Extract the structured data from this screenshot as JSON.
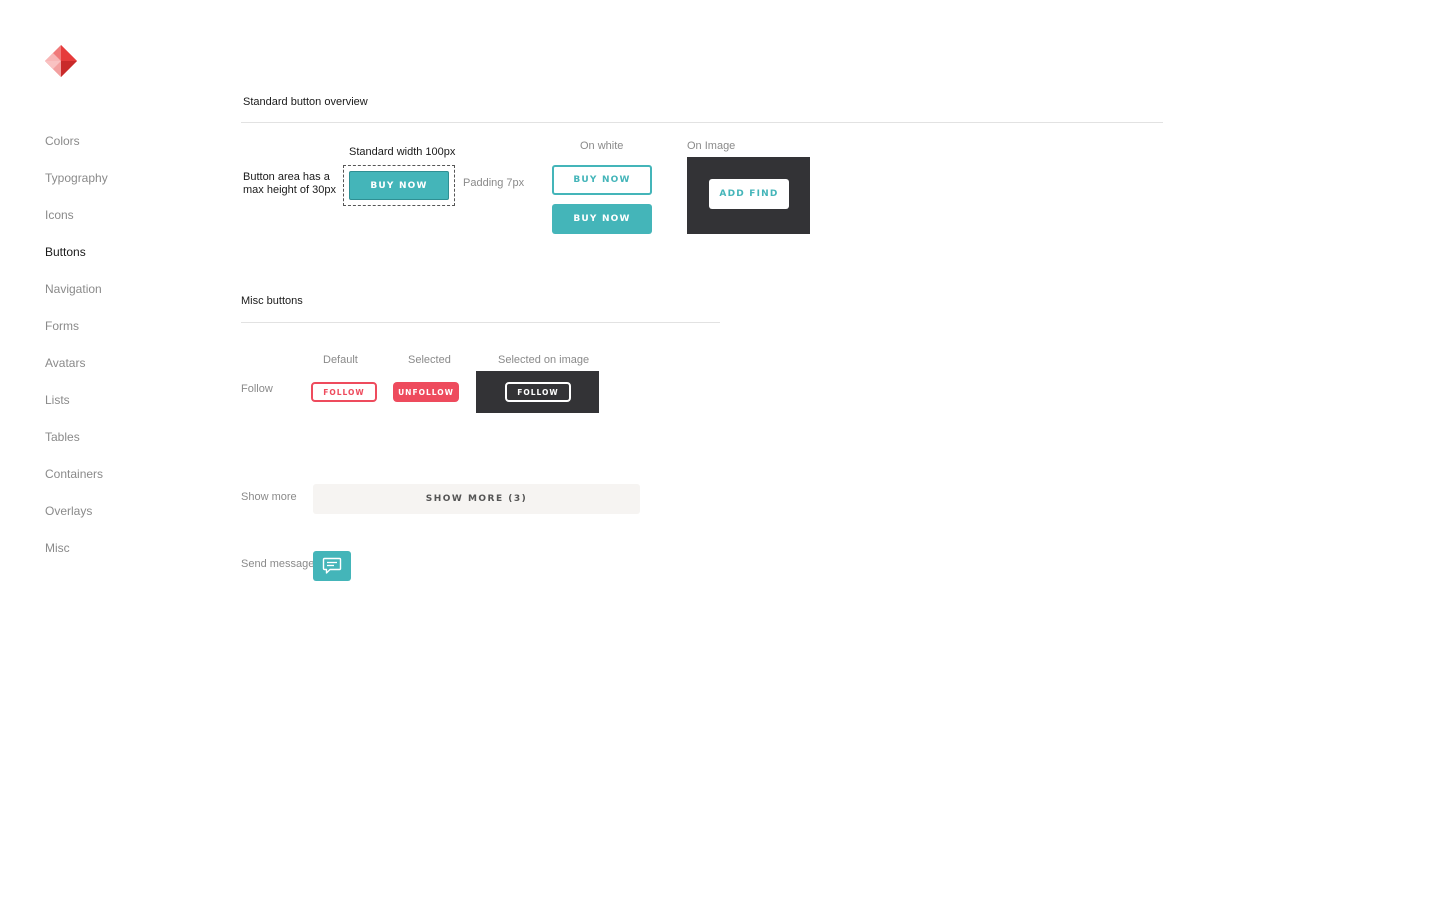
{
  "sidebar": {
    "items": [
      {
        "label": "Colors"
      },
      {
        "label": "Typography"
      },
      {
        "label": "Icons"
      },
      {
        "label": "Buttons",
        "active": true
      },
      {
        "label": "Navigation"
      },
      {
        "label": "Forms"
      },
      {
        "label": "Avatars"
      },
      {
        "label": "Lists"
      },
      {
        "label": "Tables"
      },
      {
        "label": "Containers"
      },
      {
        "label": "Overlays"
      },
      {
        "label": "Misc"
      }
    ]
  },
  "standard": {
    "title": "Standard button overview",
    "area_note": "Button area has a max height of 30px",
    "width_note": "Standard width 100px",
    "padding_note": "Padding 7px",
    "sample_button": "BUY NOW",
    "on_white_label": "On white",
    "on_white_outline": "BUY NOW",
    "on_white_solid": "BUY NOW",
    "on_image_label": "On Image",
    "on_image_button": "ADD FIND"
  },
  "misc": {
    "title": "Misc buttons",
    "follow_row_label": "Follow",
    "col_default": "Default",
    "col_selected": "Selected",
    "col_selected_image": "Selected on image",
    "follow_default": "FOLLOW",
    "follow_selected": "UNFOLLOW",
    "follow_on_image": "FOLLOW",
    "show_more_label": "Show more",
    "show_more_button": "SHOW MORE (3)",
    "send_message_label": "Send message"
  },
  "colors": {
    "teal": "#44b5b9",
    "red": "#ee4b5d",
    "dark": "#333336",
    "light_gray": "#f6f4f2"
  },
  "icons": {
    "logo": "diamond-logo-icon",
    "message": "chat-bubble-icon"
  }
}
